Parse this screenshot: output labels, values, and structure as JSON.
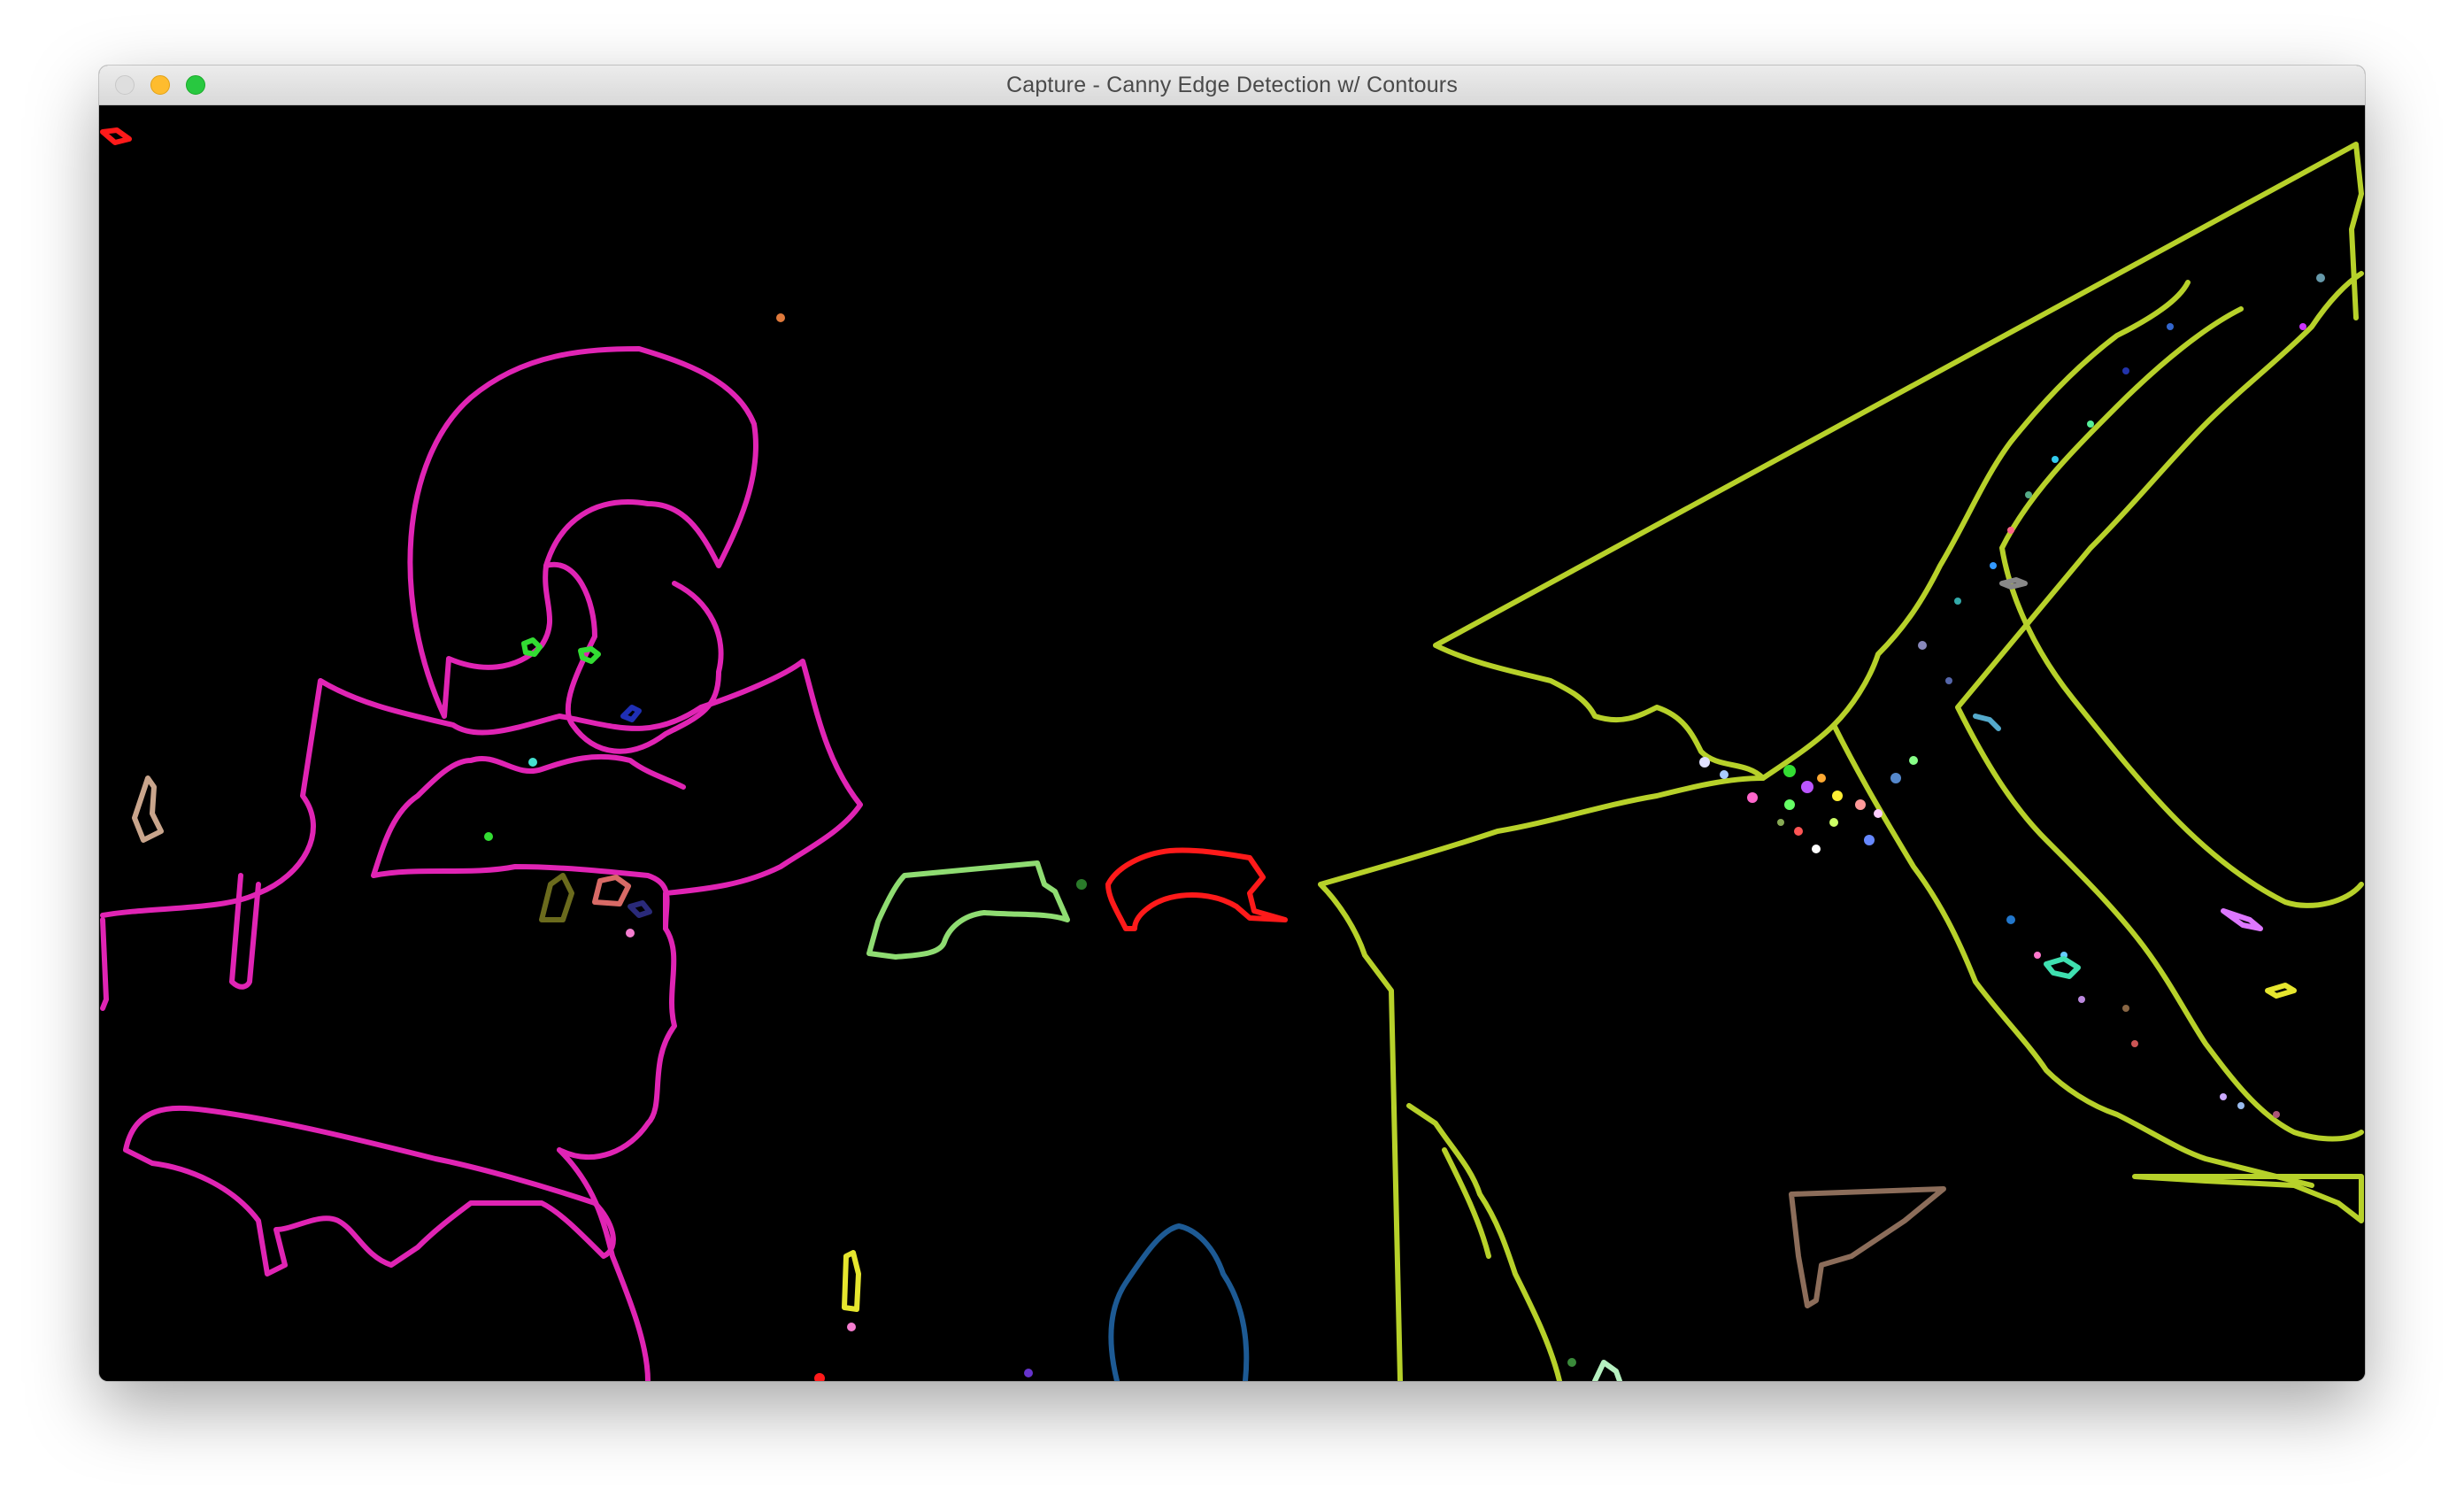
{
  "window": {
    "title": "Capture - Canny Edge Detection w/ Contours",
    "background": "#000000"
  },
  "controls": {
    "close": "close-icon",
    "minimize": "minimize-icon",
    "zoom": "zoom-icon"
  },
  "contour_colors": {
    "person": "#e024b4",
    "table_right": "#b7d12a",
    "red_object": "#ff1a1a",
    "green_object": "#8fdc72",
    "blue_object": "#1d5a94",
    "brown_object": "#8c6d5a",
    "tan_object": "#c9a58c",
    "yellow_object": "#e6e62e"
  }
}
